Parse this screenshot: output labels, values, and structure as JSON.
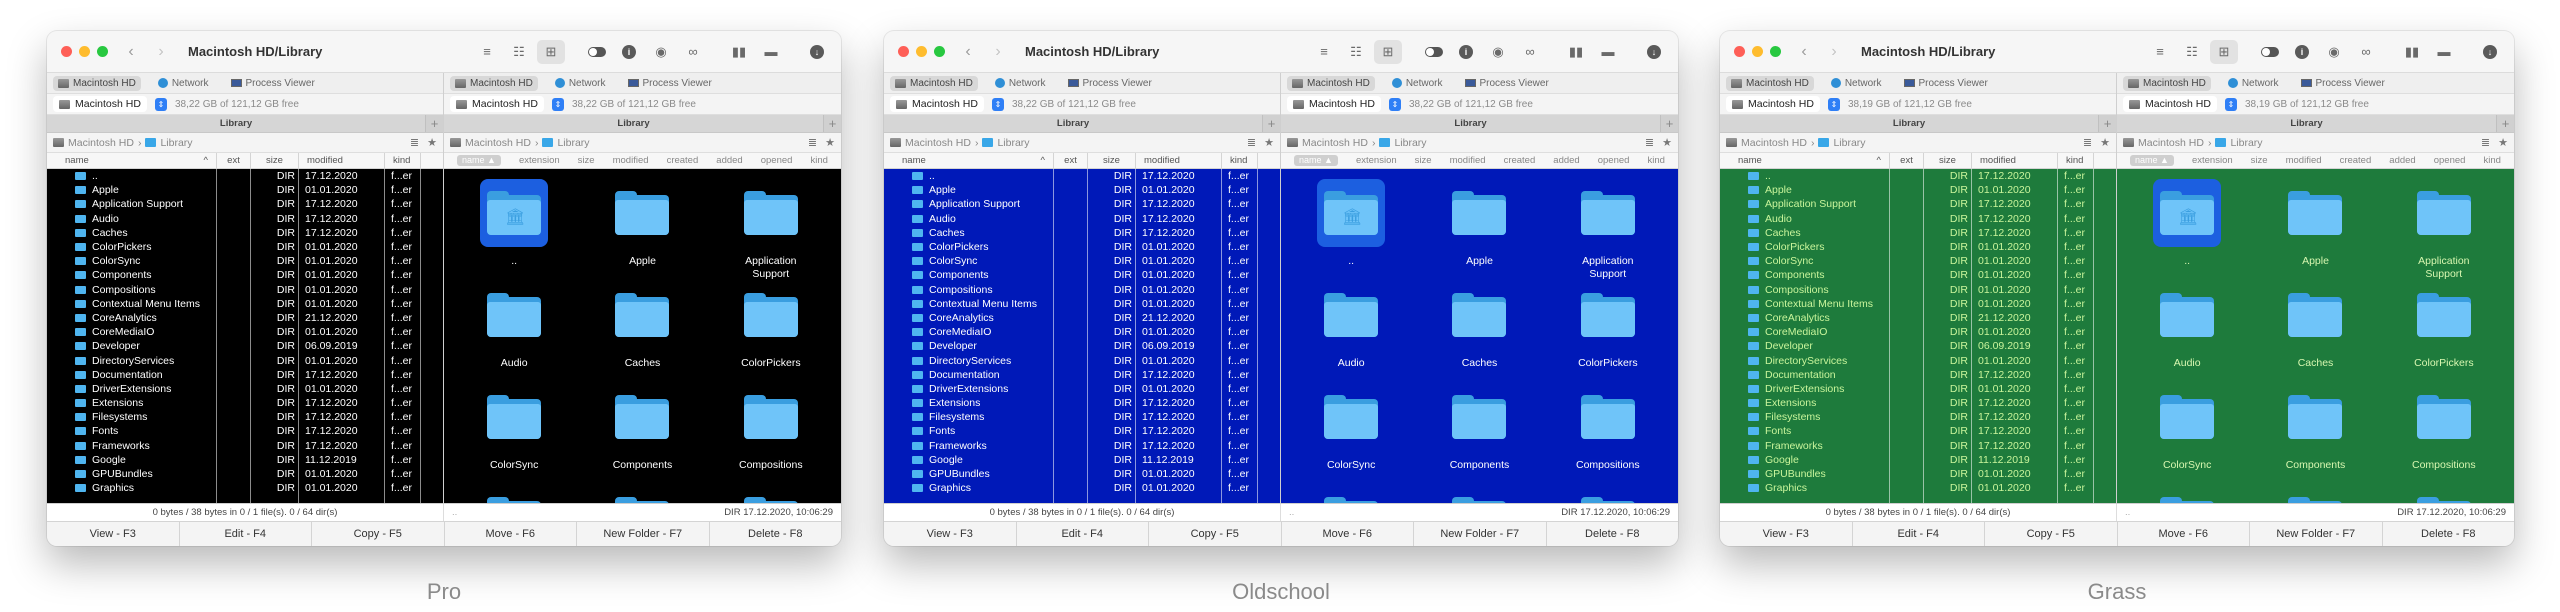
{
  "windows": [
    {
      "theme": "Pro",
      "colors": {
        "bg": "#000000",
        "text": "#ffffff",
        "grid_text": "#ffffff"
      },
      "title": "Macintosh HD/Library",
      "left": {
        "free": "38,22 GB of 121,12 GB free"
      },
      "right": {
        "free": "38,22 GB of 121,12 GB free"
      }
    },
    {
      "theme": "Oldschool",
      "colors": {
        "bg": "#0019b8",
        "text": "#ffffff",
        "grid_text": "#ffffff"
      },
      "title": "Macintosh HD/Library",
      "left": {
        "free": "38,22 GB of 121,12 GB free"
      },
      "right": {
        "free": "38,22 GB of 121,12 GB free"
      }
    },
    {
      "theme": "Grass",
      "colors": {
        "bg": "#1e7b3c",
        "text": "#c9f59b",
        "grid_text": "#d8f7b0"
      },
      "title": "Macintosh HD/Library",
      "left": {
        "free": "38,19 GB of 121,12 GB free"
      },
      "right": {
        "free": "38,19 GB of 121,12 GB free"
      }
    }
  ],
  "common": {
    "drive_tabs": [
      "Macintosh HD",
      "Network",
      "Process Viewer"
    ],
    "volume_name": "Macintosh HD",
    "tab_title": "Library",
    "tab_add": "+",
    "path": {
      "root": "Macintosh HD",
      "sep": "›",
      "folder": "Library"
    },
    "list_headers": {
      "name": "name",
      "ext": "ext",
      "size": "size",
      "modified": "modified",
      "kind": "kind"
    },
    "grid_headers": {
      "name": "name ▲",
      "extension": "extension",
      "size": "size",
      "modified": "modified",
      "created": "created",
      "added": "added",
      "opened": "opened",
      "kind": "kind"
    },
    "rows": [
      {
        "name": "..",
        "size": "DIR",
        "modified": "17.12.2020",
        "kind": "f...er"
      },
      {
        "name": "Apple",
        "size": "DIR",
        "modified": "01.01.2020",
        "kind": "f...er"
      },
      {
        "name": "Application Support",
        "size": "DIR",
        "modified": "17.12.2020",
        "kind": "f...er"
      },
      {
        "name": "Audio",
        "size": "DIR",
        "modified": "17.12.2020",
        "kind": "f...er"
      },
      {
        "name": "Caches",
        "size": "DIR",
        "modified": "17.12.2020",
        "kind": "f...er"
      },
      {
        "name": "ColorPickers",
        "size": "DIR",
        "modified": "01.01.2020",
        "kind": "f...er"
      },
      {
        "name": "ColorSync",
        "size": "DIR",
        "modified": "01.01.2020",
        "kind": "f...er"
      },
      {
        "name": "Components",
        "size": "DIR",
        "modified": "01.01.2020",
        "kind": "f...er"
      },
      {
        "name": "Compositions",
        "size": "DIR",
        "modified": "01.01.2020",
        "kind": "f...er"
      },
      {
        "name": "Contextual Menu Items",
        "size": "DIR",
        "modified": "01.01.2020",
        "kind": "f...er"
      },
      {
        "name": "CoreAnalytics",
        "size": "DIR",
        "modified": "21.12.2020",
        "kind": "f...er"
      },
      {
        "name": "CoreMediaIO",
        "size": "DIR",
        "modified": "01.01.2020",
        "kind": "f...er"
      },
      {
        "name": "Developer",
        "size": "DIR",
        "modified": "06.09.2019",
        "kind": "f...er"
      },
      {
        "name": "DirectoryServices",
        "size": "DIR",
        "modified": "01.01.2020",
        "kind": "f...er"
      },
      {
        "name": "Documentation",
        "size": "DIR",
        "modified": "17.12.2020",
        "kind": "f...er"
      },
      {
        "name": "DriverExtensions",
        "size": "DIR",
        "modified": "01.01.2020",
        "kind": "f...er"
      },
      {
        "name": "Extensions",
        "size": "DIR",
        "modified": "17.12.2020",
        "kind": "f...er"
      },
      {
        "name": "Filesystems",
        "size": "DIR",
        "modified": "17.12.2020",
        "kind": "f...er"
      },
      {
        "name": "Fonts",
        "size": "DIR",
        "modified": "17.12.2020",
        "kind": "f...er"
      },
      {
        "name": "Frameworks",
        "size": "DIR",
        "modified": "17.12.2020",
        "kind": "f...er"
      },
      {
        "name": "Google",
        "size": "DIR",
        "modified": "11.12.2019",
        "kind": "f...er"
      },
      {
        "name": "GPUBundles",
        "size": "DIR",
        "modified": "01.01.2020",
        "kind": "f...er"
      },
      {
        "name": "Graphics",
        "size": "DIR",
        "modified": "01.01.2020",
        "kind": "f...er"
      }
    ],
    "grid_items": [
      "..",
      "Apple",
      "Application Support",
      "Audio",
      "Caches",
      "ColorPickers",
      "ColorSync",
      "Components",
      "Compositions",
      "",
      "",
      ""
    ],
    "status_left": "0 bytes / 38 bytes in 0 / 1 file(s). 0 / 64 dir(s)",
    "status_right_name": "..",
    "status_right_info": "DIR   17.12.2020, 10:06:29",
    "fkeys": [
      "View - F3",
      "Edit - F4",
      "Copy - F5",
      "Move - F6",
      "New Folder - F7",
      "Delete - F8"
    ],
    "icons": {
      "back": "‹",
      "forward": "›",
      "view_brief": "≡",
      "view_list": "☷",
      "view_icons": "⊞",
      "toggle": "toggle-icon",
      "info": "i",
      "eye": "◉",
      "binoculars": "∞",
      "pane": "▮▮",
      "network_folder": "▬",
      "download": "↓",
      "menu": "≣",
      "star": "★",
      "library": "🏛"
    }
  }
}
